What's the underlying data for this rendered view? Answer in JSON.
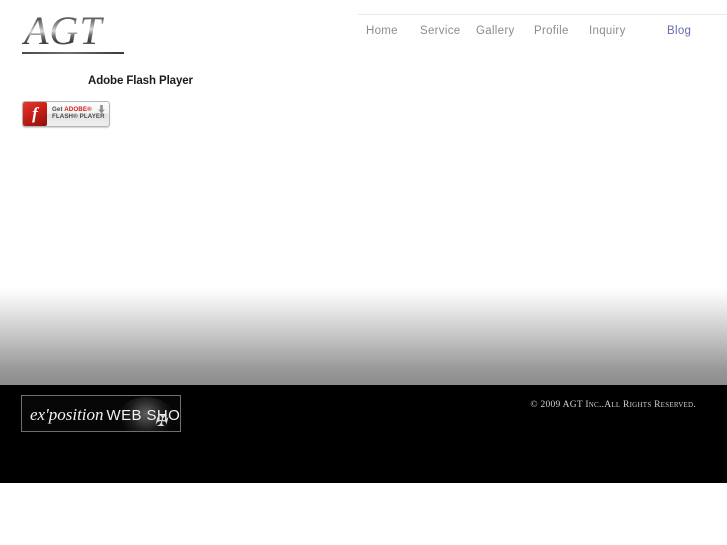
{
  "header": {
    "logo_text": "AGT",
    "nav": [
      {
        "label": "Home",
        "accent": false
      },
      {
        "label": "Service",
        "accent": false
      },
      {
        "label": "Gallery",
        "accent": false
      },
      {
        "label": "Profile",
        "accent": false
      },
      {
        "label": "Inquiry",
        "accent": false
      },
      {
        "label": "Blog",
        "accent": true
      }
    ]
  },
  "main": {
    "flash_heading": "Adobe Flash Player",
    "flash_badge": {
      "line1_prefix": "Get ",
      "line1_brand": "ADOBE®",
      "line2": "FLASH® PLAYER",
      "logo_glyph": "f",
      "arrow_icon": "download-arrow-icon"
    }
  },
  "footer": {
    "shop_banner": {
      "italic_text": "ex'position",
      "plain_text": "WEB SHOP",
      "mark_glyph": "✠"
    },
    "copyright": "© 2009 AGT Inc..All Rights Reserved."
  },
  "colors": {
    "page_background": "#ffffff",
    "footer_background": "#000000",
    "nav_text": "#8d8d8d",
    "nav_accent": "#6a6ab4",
    "flash_red": "#cf1f1a",
    "gradient_top": "#ffffff",
    "gradient_bottom": "#8c8c8c"
  }
}
